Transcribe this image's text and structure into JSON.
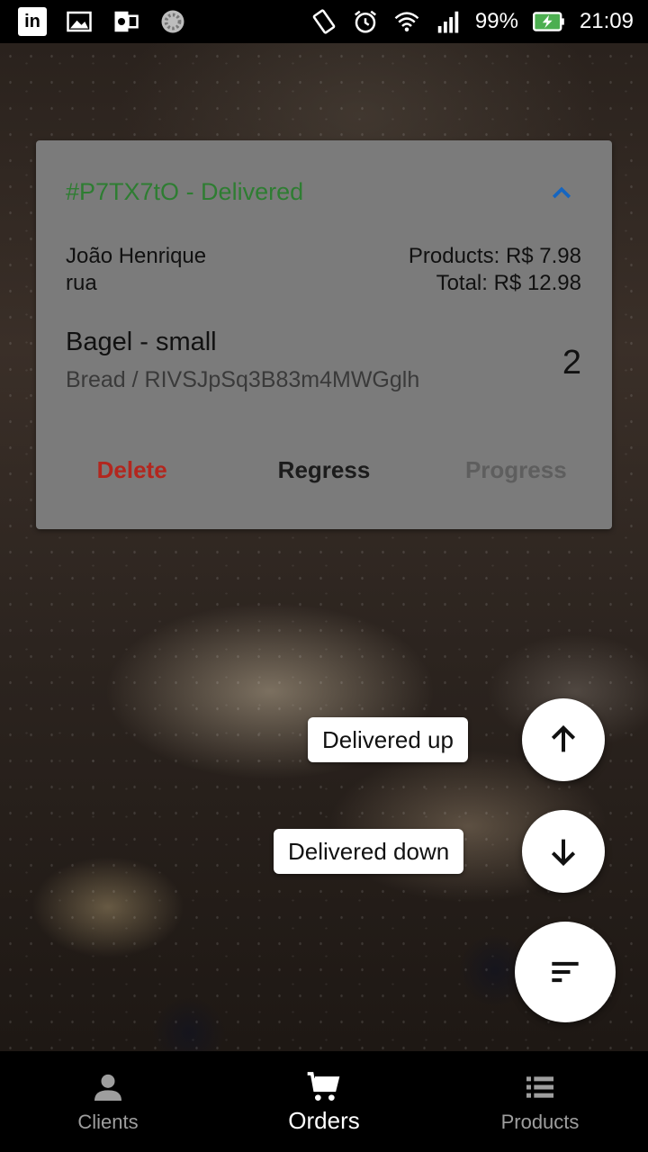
{
  "status_bar": {
    "battery": "99%",
    "time": "21:09"
  },
  "order": {
    "title": "#P7TX7tO - Delivered",
    "client_name": "João Henrique",
    "client_address": "rua",
    "products_total": "Products: R$ 7.98",
    "grand_total": "Total: R$ 12.98",
    "item": {
      "name": "Bagel - small",
      "detail": "Bread / RIVSJpSq3B83m4MWGglh",
      "quantity": "2"
    },
    "actions": {
      "delete": "Delete",
      "regress": "Regress",
      "progress": "Progress"
    },
    "title_color": "#2e7d32",
    "collapse_icon_color": "#1565c0",
    "delete_color": "#b3261e"
  },
  "fab_menu": {
    "up_label": "Delivered up",
    "down_label": "Delivered down",
    "up_icon": "arrow-up-icon",
    "down_icon": "arrow-down-icon",
    "sort_icon": "sort-icon"
  },
  "bottom_nav": {
    "items": [
      {
        "label": "Clients",
        "icon": "person-icon",
        "active": false
      },
      {
        "label": "Orders",
        "icon": "cart-icon",
        "active": true
      },
      {
        "label": "Products",
        "icon": "list-icon",
        "active": false
      }
    ]
  }
}
